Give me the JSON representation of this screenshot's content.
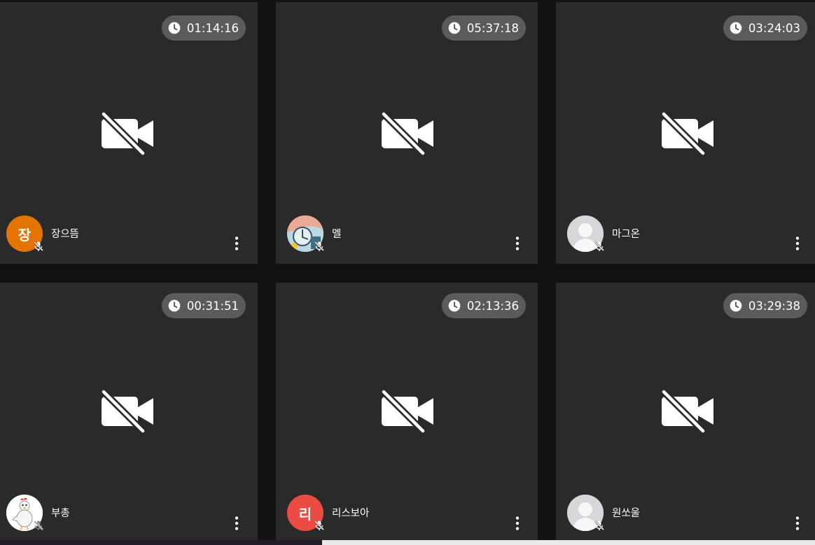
{
  "tiles": [
    {
      "timer": "01:14:16",
      "name": "장으뜸",
      "avatar_type": "initial",
      "avatar_text": "장",
      "avatar_color": "#e37400"
    },
    {
      "timer": "05:37:18",
      "name": "멜",
      "avatar_type": "photo",
      "avatar_text": "",
      "avatar_color": "#a7cbd6"
    },
    {
      "timer": "03:24:03",
      "name": "마그온",
      "avatar_type": "default",
      "avatar_text": "",
      "avatar_color": "#d5d7da"
    },
    {
      "timer": "00:31:51",
      "name": "부총",
      "avatar_type": "chicken",
      "avatar_text": "",
      "avatar_color": "#ffffff"
    },
    {
      "timer": "02:13:36",
      "name": "리스보아",
      "avatar_type": "initial",
      "avatar_text": "리",
      "avatar_color": "#ea4c44"
    },
    {
      "timer": "03:29:38",
      "name": "원쏘울",
      "avatar_type": "default",
      "avatar_text": "",
      "avatar_color": "#d5d7da"
    }
  ],
  "icons": {
    "timer": "clock-icon",
    "camera": "video-camera-off-icon",
    "mic": "mic-off-icon",
    "menu": "more-vert-icon"
  },
  "colors": {
    "tile_bg": "#2a2a2a",
    "gap_bg": "#121212",
    "timer_bg": "#5b5b5b"
  }
}
